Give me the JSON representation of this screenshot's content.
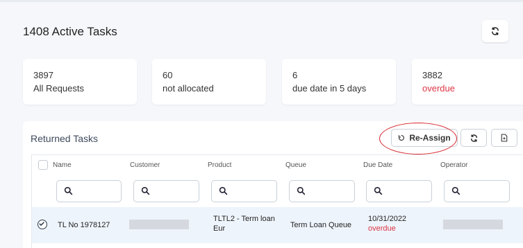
{
  "header": {
    "title": "1408 Active Tasks"
  },
  "stats": [
    {
      "value": "3897",
      "label": "All Requests"
    },
    {
      "value": "60",
      "label": "not allocated"
    },
    {
      "value": "6",
      "label": "due date in 5 days"
    },
    {
      "value": "3882",
      "label": "overdue"
    }
  ],
  "panel": {
    "title": "Returned Tasks",
    "reassign_label": "Re-Assign"
  },
  "table": {
    "columns": [
      "Name",
      "Customer",
      "Product",
      "Queue",
      "Due Date",
      "Operator"
    ],
    "rows": [
      {
        "name": "TL No 1978127",
        "customer": "",
        "product_line1": "TLTL2 - Term loan",
        "product_line2": "Eur",
        "queue": "Term Loan Queue",
        "due_date": "10/31/2022",
        "due_status": "overdue",
        "operator": ""
      }
    ]
  },
  "colors": {
    "overdue": "#dc3545",
    "annotation": "#d6252c",
    "row_selected": "#eef4fb"
  },
  "icons": [
    "refresh-icon",
    "search-icon",
    "export-icon",
    "checkbox-icon"
  ]
}
